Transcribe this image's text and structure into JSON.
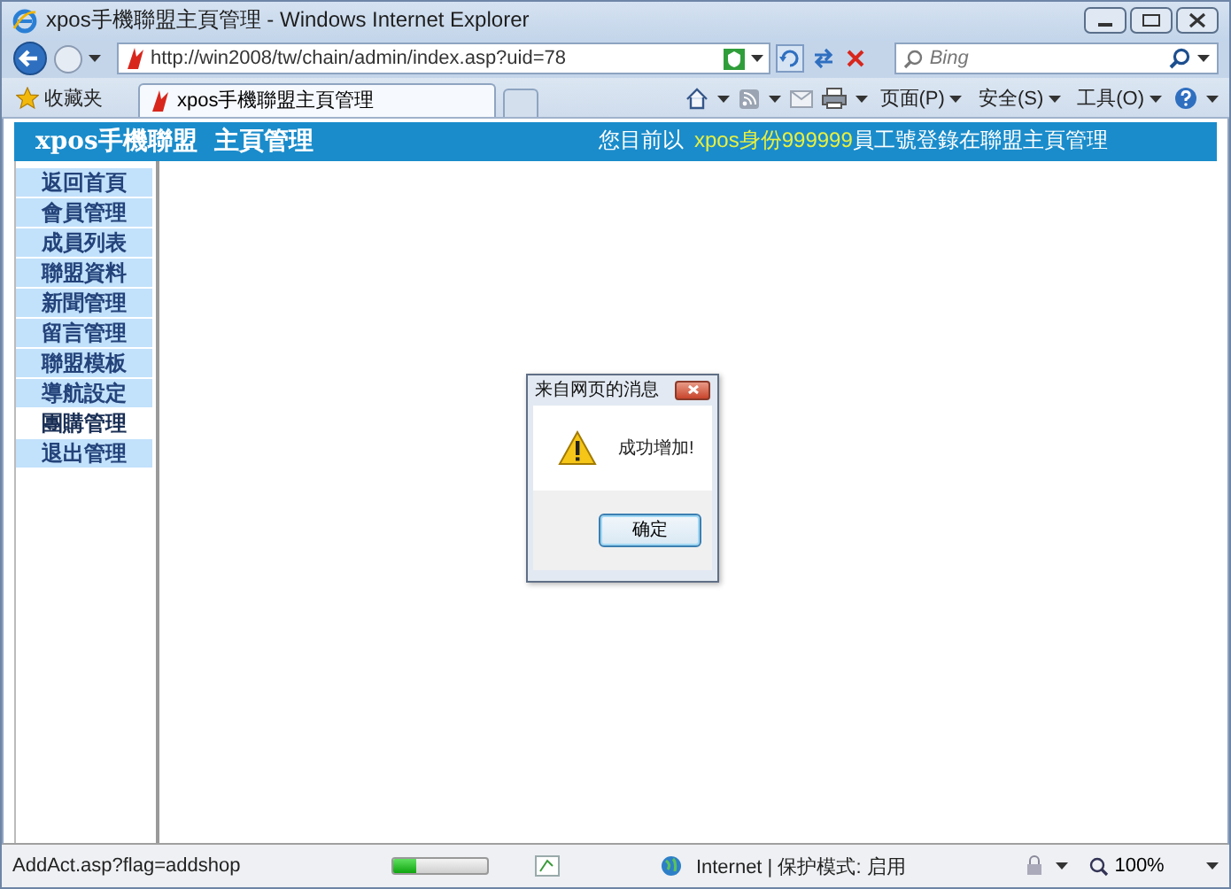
{
  "window": {
    "title": "xpos手機聯盟主頁管理 - Windows Internet Explorer"
  },
  "address_bar": {
    "url": "http://win2008/tw/chain/admin/index.asp?uid=78"
  },
  "search": {
    "placeholder": "Bing"
  },
  "favorites": {
    "label": "收藏夹"
  },
  "tabs": [
    {
      "label": "xpos手機聯盟主頁管理",
      "selected": true
    }
  ],
  "commands": [
    "页面(P)",
    "安全(S)",
    "工具(O)"
  ],
  "header": {
    "title": "xpos手機聯盟  主頁管理",
    "status_prefix": "您目前以",
    "user": "xpos身份999999",
    "status_suffix": "員工號登錄在聯盟主頁管理"
  },
  "sidebar": {
    "items": [
      {
        "label": "返回首頁",
        "selected": false
      },
      {
        "label": "會員管理",
        "selected": false
      },
      {
        "label": "成員列表",
        "selected": false
      },
      {
        "label": "聯盟資料",
        "selected": false
      },
      {
        "label": "新聞管理",
        "selected": false
      },
      {
        "label": "留言管理",
        "selected": false
      },
      {
        "label": "聯盟模板",
        "selected": false
      },
      {
        "label": "導航設定",
        "selected": false
      },
      {
        "label": "團購管理",
        "selected": true
      },
      {
        "label": "退出管理",
        "selected": false
      }
    ]
  },
  "dialog": {
    "title": "来自网页的消息",
    "message": "成功增加!",
    "button": "确定"
  },
  "status_bar": {
    "text": "AddAct.asp?flag=addshop",
    "progress": {
      "level": 0.25
    },
    "zone": "Internet | 保护模式: 启用",
    "zoom": "100%"
  }
}
